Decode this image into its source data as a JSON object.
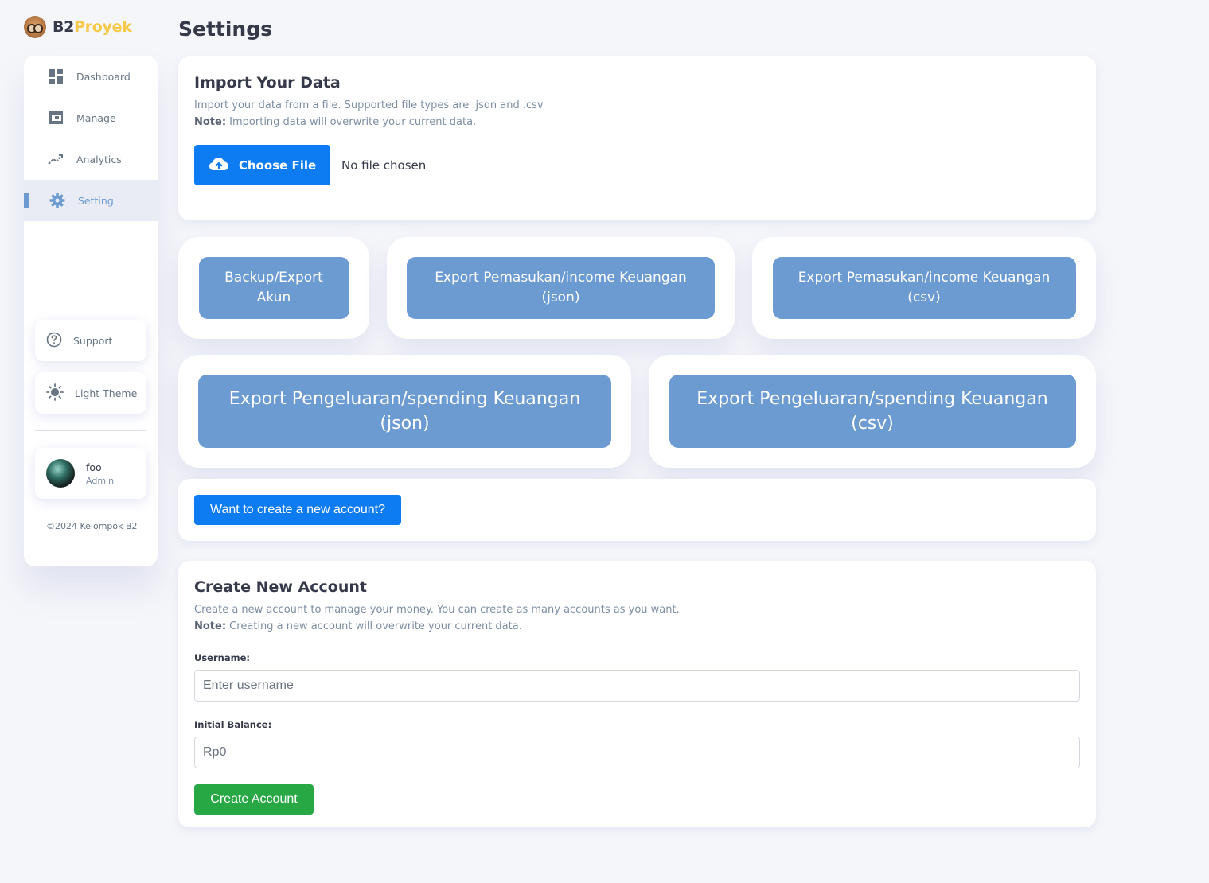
{
  "brand": {
    "prefix": "B2",
    "suffix": "Proyek"
  },
  "page": {
    "title": "Settings"
  },
  "sidebar": {
    "items": [
      {
        "label": "Dashboard",
        "icon": "dashboard-icon"
      },
      {
        "label": "Manage",
        "icon": "wallet-icon"
      },
      {
        "label": "Analytics",
        "icon": "analytics-icon"
      },
      {
        "label": "Setting",
        "icon": "gear-icon",
        "active": true
      }
    ],
    "support_label": "Support",
    "theme_label": "Light Theme",
    "profile": {
      "name": "foo",
      "role": "Admin"
    },
    "copyright": "©2024 Kelompok B2"
  },
  "import": {
    "title": "Import Your Data",
    "description": "Import your data from a file. Supported file types are .json and .csv",
    "note_label": "Note:",
    "note_text": " Importing data will overwrite your current data.",
    "choose_label": "Choose File",
    "file_status": "No file chosen"
  },
  "exports": {
    "backup_l1": "Backup/Export",
    "backup_l2": "Akun",
    "income_json_l1": "Export Pemasukan/income Keuangan",
    "income_json_l2": "(json)",
    "income_csv_l1": "Export Pemasukan/income Keuangan",
    "income_csv_l2": "(csv)",
    "spending_json_l1": "Export Pengeluaran/spending Keuangan",
    "spending_json_l2": "(json)",
    "spending_csv_l1": "Export Pengeluaran/spending Keuangan",
    "spending_csv_l2": "(csv)"
  },
  "cta": {
    "label": "Want to create a new account?"
  },
  "create": {
    "title": "Create New Account",
    "description": "Create a new account to manage your money. You can create as many accounts as you want.",
    "note_label": "Note:",
    "note_text": " Creating a new account will overwrite your current data.",
    "username_label": "Username:",
    "username_placeholder": "Enter username",
    "balance_label": "Initial Balance:",
    "balance_placeholder": "Rp0",
    "submit_label": "Create Account"
  },
  "colors": {
    "primary": "#0d7bf2",
    "accent": "#6c9bcf",
    "export_button": "#6c9bd2",
    "success": "#28a745",
    "brand_yellow": "#f7c948"
  }
}
